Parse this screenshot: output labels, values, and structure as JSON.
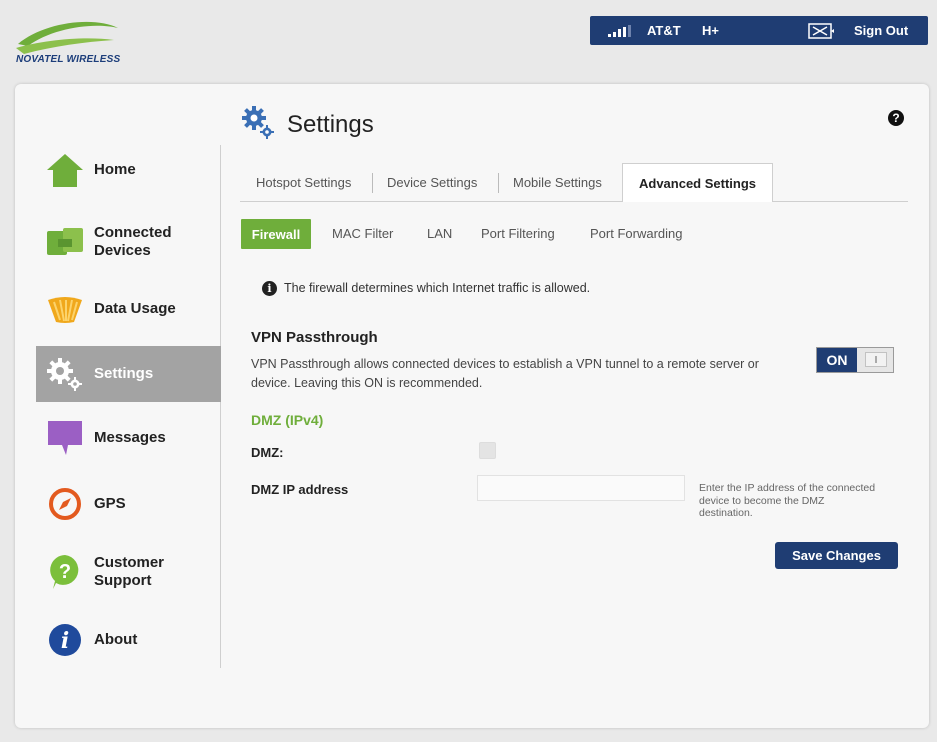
{
  "header": {
    "logo_text": "NOVATEL WIRELESS",
    "carrier": "AT&T",
    "network": "H+",
    "signout_label": "Sign Out",
    "signal_icon": "signal-bars-icon",
    "message_icon": "message-box-icon"
  },
  "sidebar": {
    "items": [
      {
        "label": "Home",
        "icon": "home-icon"
      },
      {
        "label": "Connected\nDevices",
        "icon": "connected-devices-icon"
      },
      {
        "label": "Data Usage",
        "icon": "data-usage-icon"
      },
      {
        "label": "Settings",
        "icon": "gear-icon",
        "active": true
      },
      {
        "label": "Messages",
        "icon": "messages-icon"
      },
      {
        "label": "GPS",
        "icon": "compass-icon"
      },
      {
        "label": "Customer\nSupport",
        "icon": "support-icon"
      },
      {
        "label": "About",
        "icon": "info-icon"
      }
    ]
  },
  "main": {
    "title": "Settings",
    "help_symbol": "?",
    "tabs": [
      {
        "label": "Hotspot Settings"
      },
      {
        "label": "Device Settings"
      },
      {
        "label": "Mobile Settings"
      },
      {
        "label": "Advanced Settings",
        "active": true
      }
    ],
    "subtabs": [
      {
        "label": "Firewall",
        "active": true
      },
      {
        "label": "MAC Filter"
      },
      {
        "label": "LAN"
      },
      {
        "label": "Port Filtering"
      },
      {
        "label": "Port Forwarding"
      }
    ],
    "info_text": "The firewall determines which Internet traffic is allowed.",
    "vpn": {
      "title": "VPN Passthrough",
      "description": "VPN Passthrough allows connected devices to establish a VPN tunnel to a remote server or device. Leaving this ON is recommended.",
      "toggle_label": "ON",
      "enabled": true
    },
    "dmz": {
      "title": "DMZ (IPv4)",
      "dmz_label": "DMZ:",
      "dmz_checked": false,
      "ip_label": "DMZ IP address",
      "ip_value": "",
      "ip_hint": "Enter the IP address of the connected device to become the DMZ destination."
    },
    "save_label": "Save Changes"
  },
  "colors": {
    "brand_navy": "#1f3d73",
    "accent_green": "#6fae3b",
    "active_nav": "#a3a3a3"
  }
}
